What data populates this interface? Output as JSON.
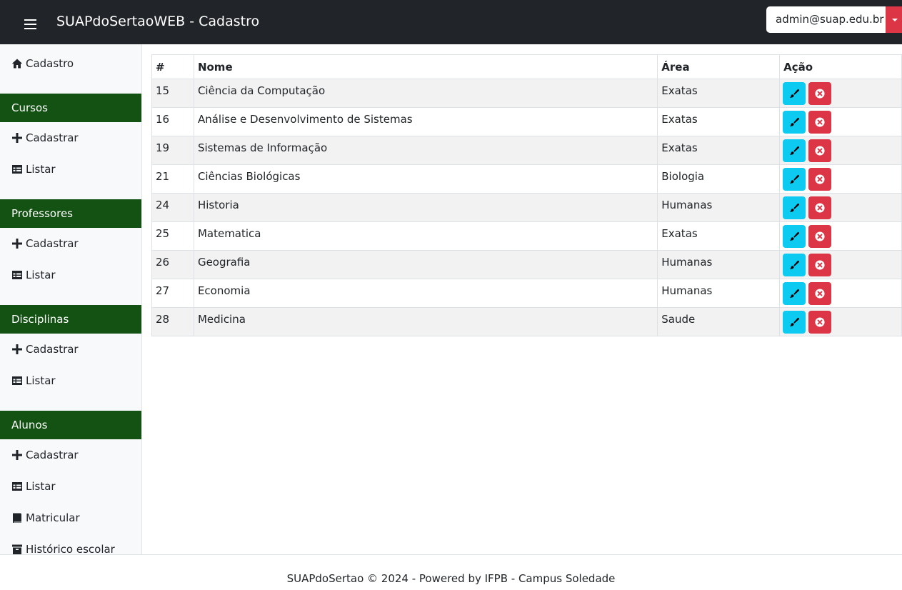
{
  "header": {
    "title": "SUAPdoSertaoWEB - Cadastro",
    "user": "admin@suap.edu.br",
    "menu_icon": "hamburger-icon",
    "dropdown_icon": "caret-down-icon"
  },
  "sidebar": {
    "home": {
      "label": "Cadastro",
      "icon": "home-icon"
    },
    "sections": [
      {
        "title": "Cursos",
        "items": [
          {
            "label": "Cadastrar",
            "icon": "plus-icon"
          },
          {
            "label": "Listar",
            "icon": "table-icon"
          }
        ]
      },
      {
        "title": "Professores",
        "items": [
          {
            "label": "Cadastrar",
            "icon": "plus-icon"
          },
          {
            "label": "Listar",
            "icon": "table-icon"
          }
        ]
      },
      {
        "title": "Disciplinas",
        "items": [
          {
            "label": "Cadastrar",
            "icon": "plus-icon"
          },
          {
            "label": "Listar",
            "icon": "table-icon"
          }
        ]
      },
      {
        "title": "Alunos",
        "items": [
          {
            "label": "Cadastrar",
            "icon": "plus-icon"
          },
          {
            "label": "Listar",
            "icon": "table-icon"
          },
          {
            "label": "Matricular",
            "icon": "book-icon"
          },
          {
            "label": "Histórico escolar",
            "icon": "archive-icon"
          }
        ]
      }
    ]
  },
  "table": {
    "headers": [
      "#",
      "Nome",
      "Área",
      "Ação"
    ],
    "rows": [
      {
        "id": "15",
        "nome": "Ciência da Computação",
        "area": "Exatas"
      },
      {
        "id": "16",
        "nome": "Análise e Desenvolvimento de Sistemas",
        "area": "Exatas"
      },
      {
        "id": "19",
        "nome": "Sistemas de Informação",
        "area": "Exatas"
      },
      {
        "id": "21",
        "nome": "Ciências Biológicas",
        "area": "Biologia"
      },
      {
        "id": "24",
        "nome": "Historia",
        "area": "Humanas"
      },
      {
        "id": "25",
        "nome": "Matematica",
        "area": "Exatas"
      },
      {
        "id": "26",
        "nome": "Geografia",
        "area": "Humanas"
      },
      {
        "id": "27",
        "nome": "Economia",
        "area": "Humanas"
      },
      {
        "id": "28",
        "nome": "Medicina",
        "area": "Saude"
      }
    ],
    "edit_icon": "brush-icon",
    "delete_icon": "x-circle-icon"
  },
  "footer": {
    "text": "SUAPdoSertao © 2024 - Powered by IFPB - Campus Soledade"
  },
  "colors": {
    "navbar": "#212529",
    "sidebar_section": "#145214",
    "edit_button": "#0dcaf0",
    "delete_button": "#dc3545"
  }
}
